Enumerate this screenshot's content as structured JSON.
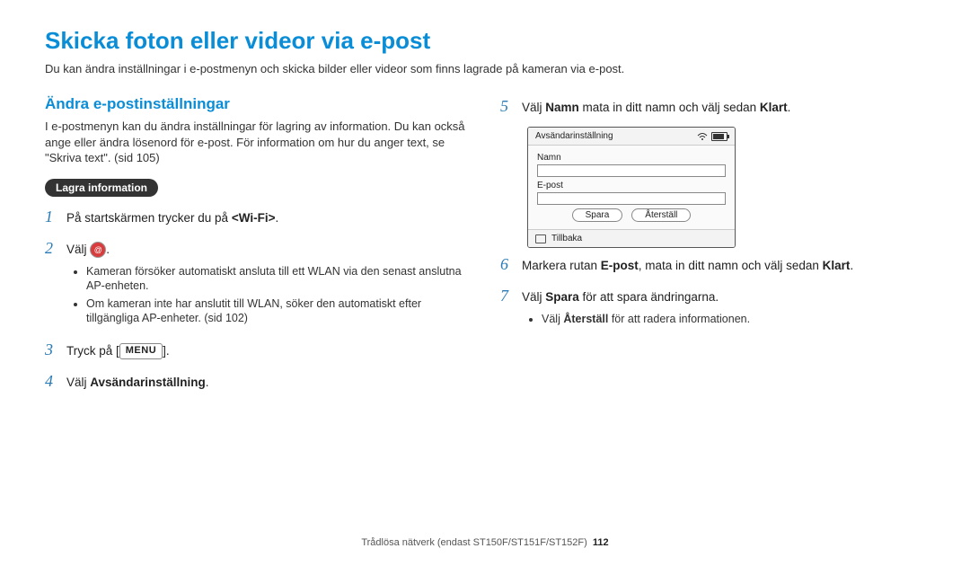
{
  "title": "Skicka foton eller videor via e-post",
  "subtitle": "Du kan ändra inställningar i e-postmenyn och skicka bilder eller videor som finns lagrade på kameran via e-post.",
  "left": {
    "section_title": "Ändra e-postinställningar",
    "section_desc": "I e-postmenyn kan du ändra inställningar för lagring av information. Du kan också ange eller ändra lösenord för e-post. För information om hur du anger text, se \"Skriva text\". (sid 105)",
    "pill": "Lagra information",
    "steps": {
      "1": {
        "pre": "På startskärmen trycker du på ",
        "bold1": "<Wi‑Fi>",
        "post": "."
      },
      "2": {
        "text": "Välj "
      },
      "2_bullets": [
        "Kameran försöker automatiskt ansluta till ett WLAN via den senast anslutna AP-enheten.",
        "Om kameran inte har anslutit till WLAN, söker den automatiskt efter tillgängliga AP-enheter. (sid 102)"
      ],
      "3": {
        "pre": "Tryck på [",
        "post": "]."
      },
      "4": {
        "pre": "Välj ",
        "bold1": "Avsändarinställning",
        "post": "."
      }
    },
    "menu_label": "MENU"
  },
  "right": {
    "steps": {
      "5": {
        "pre": "Välj ",
        "bold1": "Namn",
        "mid": " mata in ditt namn och välj sedan ",
        "bold2": "Klart",
        "post": "."
      },
      "6": {
        "pre": "Markera rutan ",
        "bold1": "E-post",
        "mid": ", mata in ditt namn och välj sedan ",
        "bold2": "Klart",
        "post": "."
      },
      "7": {
        "pre": "Välj ",
        "bold1": "Spara",
        "post": " för att spara ändringarna."
      },
      "7_bullets": [
        {
          "pre": "Välj ",
          "bold1": "Återställ",
          "post": " för att radera informationen."
        }
      ]
    }
  },
  "device": {
    "top_title": "Avsändarinställning",
    "label_name": "Namn",
    "label_email": "E-post",
    "btn_save": "Spara",
    "btn_reset": "Återställ",
    "footer_back": "Tillbaka"
  },
  "footer": {
    "text": "Trådlösa nätverk (endast ST150F/ST151F/ST152F)",
    "page": "112"
  }
}
